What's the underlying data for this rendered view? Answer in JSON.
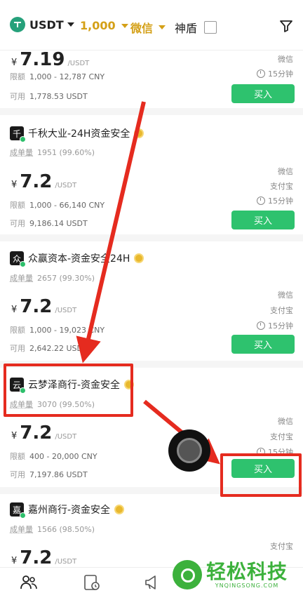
{
  "topbar": {
    "coin": "USDT",
    "amount": "1,000",
    "payment": "微信",
    "shield": "神盾"
  },
  "labels": {
    "orders": "成单量",
    "limit": "限额",
    "available": "可用",
    "unit": "/USDT",
    "yen": "¥",
    "buy": "买入"
  },
  "offers": [
    {
      "price": "7.19",
      "limit": "1,000 - 12,787 CNY",
      "available": "1,778.53 USDT",
      "payments": [
        "微信"
      ],
      "time": "15分钟"
    },
    {
      "avatar": "千",
      "name": "千秋大业-24H资金安全",
      "orders": "1951 (99.60%)",
      "price": "7.2",
      "limit": "1,000 - 66,140 CNY",
      "available": "9,186.14 USDT",
      "payments": [
        "微信",
        "支付宝"
      ],
      "time": "15分钟"
    },
    {
      "avatar": "众",
      "name": "众赢资本-资金安全24H",
      "orders": "2657 (99.30%)",
      "price": "7.2",
      "limit": "1,000 - 19,023 CNY",
      "available": "2,642.22 USDT",
      "payments": [
        "微信",
        "支付宝"
      ],
      "time": "15分钟"
    },
    {
      "avatar": "云",
      "name": "云梦泽商行-资金安全",
      "orders": "3070 (99.50%)",
      "price": "7.2",
      "limit": "400 - 20,000 CNY",
      "available": "7,197.86 USDT",
      "payments": [
        "微信",
        "支付宝"
      ],
      "time": "15分钟"
    },
    {
      "avatar": "嘉",
      "name": "嘉州商行-资金安全",
      "orders": "1566 (98.50%)",
      "price": "7.2",
      "payments": [
        "支付宝"
      ]
    }
  ],
  "watermark": {
    "cn": "轻松科技",
    "en": "YNQINGSONG.COM"
  },
  "colors": {
    "accent": "#d4a017",
    "buy": "#2ec26e",
    "annotation": "#e52b1f",
    "watermark": "#3cb13c"
  },
  "icons": {
    "coin": "tether-logo",
    "filter": "funnel-icon",
    "nav": [
      "people-icon",
      "orders-clock-icon",
      "megaphone-icon"
    ]
  }
}
